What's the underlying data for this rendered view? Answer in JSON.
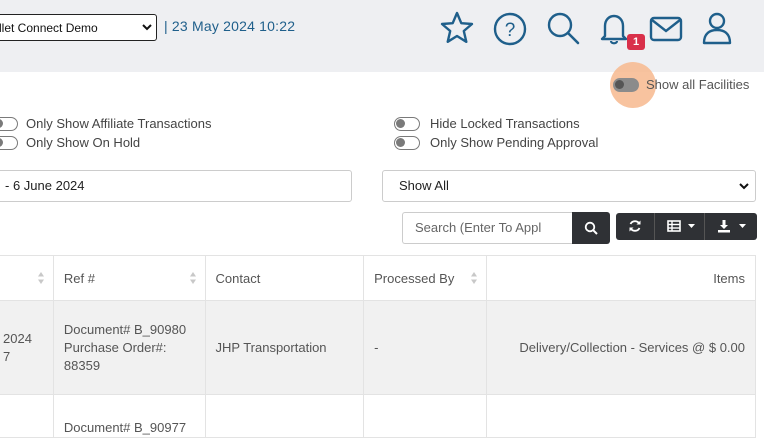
{
  "header": {
    "facility_select": "llet Connect Demo",
    "datetime": "| 23 May 2024 10:22",
    "notification_count": "1",
    "icons": [
      "star-icon",
      "help-icon",
      "search-icon",
      "bell-icon",
      "mail-icon",
      "user-icon"
    ]
  },
  "filters": {
    "show_all_facilities": "Show all Facilities",
    "only_affiliate": "Only Show Affiliate Transactions",
    "only_on_hold": "Only Show On Hold",
    "hide_locked": "Hide Locked Transactions",
    "only_pending": "Only Show Pending Approval",
    "date_range": "- 6 June 2024",
    "status_select": "Show All",
    "search_placeholder": "Search (Enter To Appl"
  },
  "table": {
    "headers": [
      "",
      "Ref #",
      "Contact",
      "Processed By",
      "Items"
    ],
    "rows": [
      {
        "date_line1": "2024",
        "date_line2": "7",
        "ref_line1": "Document# B_90980",
        "ref_line2": "Purchase Order#:",
        "ref_line3": "88359",
        "contact": "JHP Transportation",
        "processed_by": "-",
        "items": "Delivery/Collection - Services @ $ 0.00"
      },
      {
        "ref_line1": "Document# B_90977"
      }
    ]
  },
  "colors": {
    "accent": "#1f5f8b",
    "badge": "#d9304a",
    "halo": "#f7b98e",
    "dark_button": "#2f3135"
  }
}
